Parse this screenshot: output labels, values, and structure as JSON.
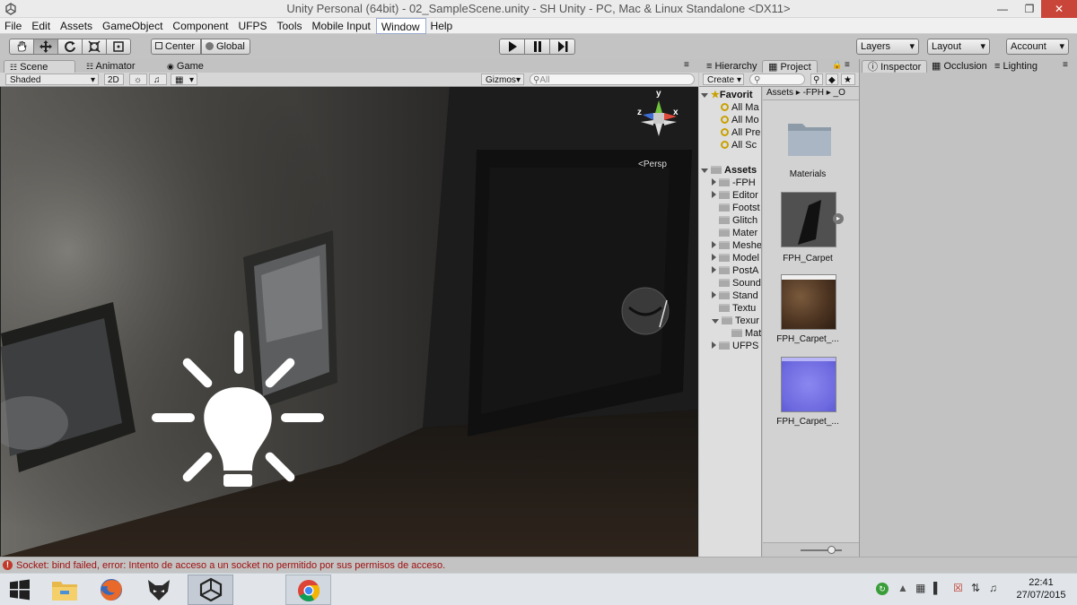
{
  "window": {
    "title": "Unity Personal (64bit) - 02_SampleScene.unity - SH Unity - PC, Mac & Linux Standalone <DX11>"
  },
  "menu": [
    "File",
    "Edit",
    "Assets",
    "GameObject",
    "Component",
    "UFPS",
    "Tools",
    "Mobile Input",
    "Window",
    "Help"
  ],
  "toolbar": {
    "pivot": "Center",
    "space": "Global",
    "layers": "Layers",
    "layout": "Layout",
    "account": "Account"
  },
  "scene_tabs": {
    "scene": "Scene",
    "animator": "Animator",
    "game": "Game"
  },
  "scene_bar": {
    "shading": "Shaded",
    "mode2d": "2D",
    "gizmos": "Gizmos",
    "search_placeholder": "All"
  },
  "gizmo": {
    "y": "y",
    "x": "x",
    "z": "z",
    "persp": "Persp"
  },
  "panel_tabs": {
    "hierarchy": "Hierarchy",
    "project": "Project",
    "create": "Create"
  },
  "project": {
    "breadcrumb": [
      "Assets",
      "-FPH",
      "_O"
    ],
    "favorites_label": "Favorit",
    "favorites": [
      "All Ma",
      "All Mo",
      "All Pre",
      "All Sc"
    ],
    "assets_label": "Assets",
    "folders": [
      "-FPH",
      "Editor",
      "Footst",
      "Glitch",
      "Mater",
      "Meshe",
      "Model",
      "PostA",
      "Sound",
      "Stand",
      "Textu",
      "Texur",
      "Mat",
      "UFPS"
    ],
    "items": [
      "Materials",
      "FPH_Carpet",
      "FPH_Carpet_...",
      "FPH_Carpet_..."
    ]
  },
  "inspector_tabs": {
    "inspector": "Inspector",
    "occlusion": "Occlusion",
    "lighting": "Lighting"
  },
  "status": {
    "message": "Socket: bind failed, error: Intento de acceso a un socket no permitido por sus permisos de acceso."
  },
  "taskbar": {
    "time": "22:41",
    "date": "27/07/2015"
  },
  "colors": {
    "error": "#c0392b",
    "accent": "#3a7bd5",
    "panel": "#c2c2c2"
  }
}
